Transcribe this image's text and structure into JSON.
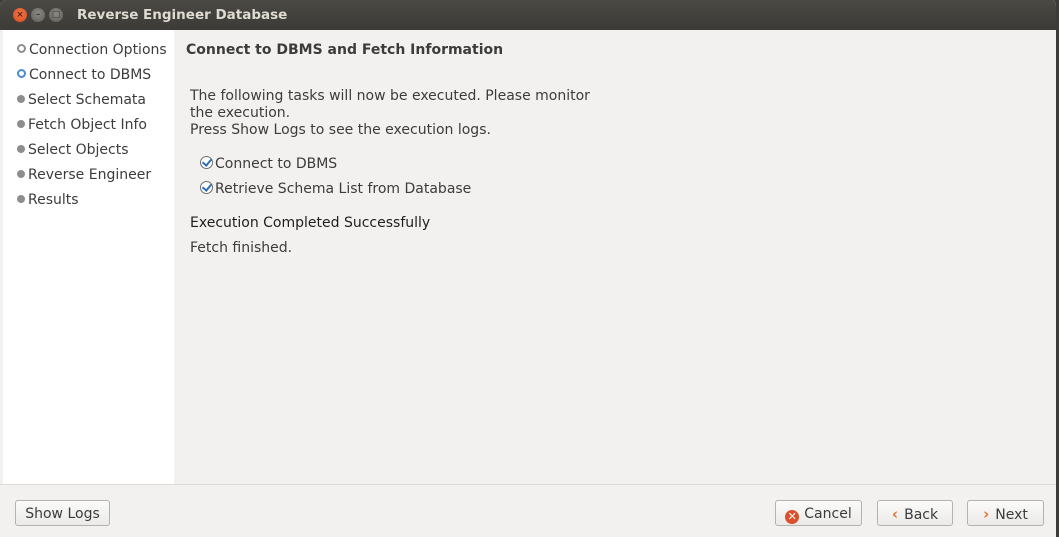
{
  "window": {
    "title": "Reverse Engineer Database"
  },
  "sidebar": {
    "steps": [
      {
        "label": "Connection Options",
        "state": "done"
      },
      {
        "label": "Connect to DBMS",
        "state": "current"
      },
      {
        "label": "Select Schemata",
        "state": "pending"
      },
      {
        "label": "Fetch Object Info",
        "state": "pending"
      },
      {
        "label": "Select Objects",
        "state": "pending"
      },
      {
        "label": "Reverse Engineer",
        "state": "pending"
      },
      {
        "label": "Results",
        "state": "pending"
      }
    ]
  },
  "main": {
    "heading": "Connect to DBMS and Fetch Information",
    "description_line1": "The following tasks will now be executed. Please monitor",
    "description_line2": "the execution.",
    "description_line3": "Press Show Logs to see the execution logs.",
    "tasks": [
      {
        "label": "Connect to DBMS",
        "done": true
      },
      {
        "label": "Retrieve Schema List from Database",
        "done": true
      }
    ],
    "status": "Execution Completed Successfully",
    "detail": "Fetch finished."
  },
  "buttons": {
    "show_logs": "Show Logs",
    "cancel": "Cancel",
    "back": "Back",
    "next": "Next"
  },
  "icons": {
    "cancel": "✕",
    "back": "‹",
    "next": "›",
    "close": "×",
    "minimize": "–",
    "maximize": "□"
  }
}
